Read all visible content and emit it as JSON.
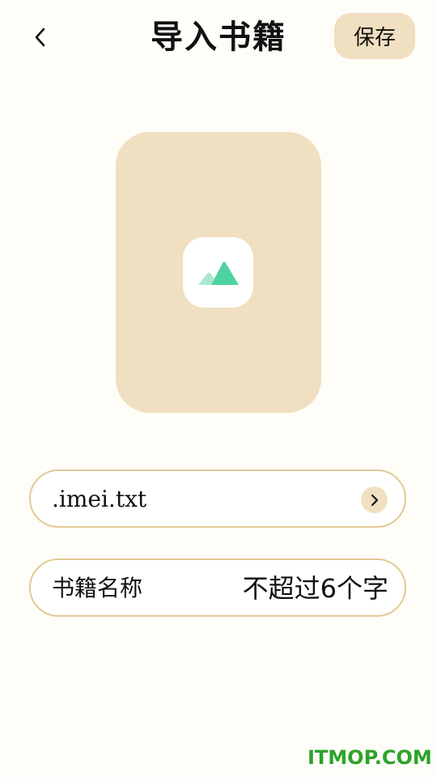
{
  "header": {
    "title": "导入书籍",
    "save_label": "保存"
  },
  "cover": {
    "icon": "image-placeholder-icon"
  },
  "file_field": {
    "value": ".imei.txt",
    "icon": "chevron-right-icon"
  },
  "name_field": {
    "label": "书籍名称",
    "placeholder": "不超过6个字"
  },
  "watermark": "ITMOP.COM",
  "colors": {
    "background": "#fefdf8",
    "accent": "#f0dfc0",
    "field_border": "#e3c996",
    "icon_green": "#4fd3a0",
    "icon_green_light": "#a8e8d0",
    "watermark": "#2ea22a"
  }
}
